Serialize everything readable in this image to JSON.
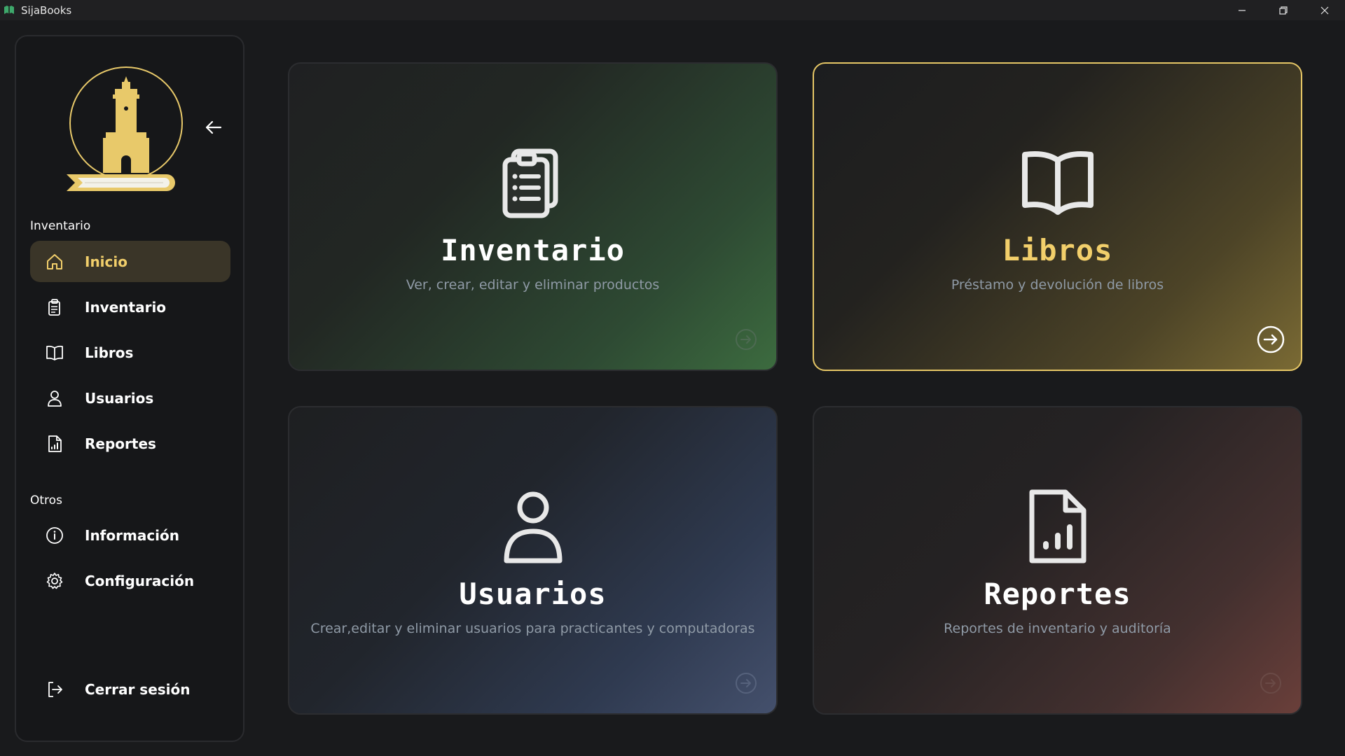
{
  "window": {
    "title": "SijaBooks"
  },
  "sidebar": {
    "sections": {
      "inventario": "Inventario",
      "otros": "Otros"
    },
    "items": [
      {
        "label": "Inicio",
        "icon": "home-icon",
        "active": true
      },
      {
        "label": "Inventario",
        "icon": "clipboard-icon",
        "active": false
      },
      {
        "label": "Libros",
        "icon": "book-icon",
        "active": false
      },
      {
        "label": "Usuarios",
        "icon": "user-icon",
        "active": false
      },
      {
        "label": "Reportes",
        "icon": "report-icon",
        "active": false
      }
    ],
    "other_items": [
      {
        "label": "Información",
        "icon": "info-icon"
      },
      {
        "label": "Configuración",
        "icon": "gear-icon"
      }
    ],
    "logout": {
      "label": "Cerrar sesión",
      "icon": "logout-icon"
    }
  },
  "cards": [
    {
      "title": "Inventario",
      "description": "Ver, crear, editar y eliminar productos",
      "icon": "clipboard-icon"
    },
    {
      "title": "Libros",
      "description": "Préstamo y devolución de libros",
      "icon": "book-open-icon"
    },
    {
      "title": "Usuarios",
      "description": "Crear,editar y eliminar usuarios para practicantes y computadoras",
      "icon": "user-icon"
    },
    {
      "title": "Reportes",
      "description": "Reportes de inventario y auditoría",
      "icon": "report-icon"
    }
  ],
  "colors": {
    "accent": "#f2cf6b",
    "background": "#191a1c",
    "sidebar_bg": "#161719",
    "active_item_bg": "#3a3528",
    "description_text": "#8f9aa6"
  }
}
